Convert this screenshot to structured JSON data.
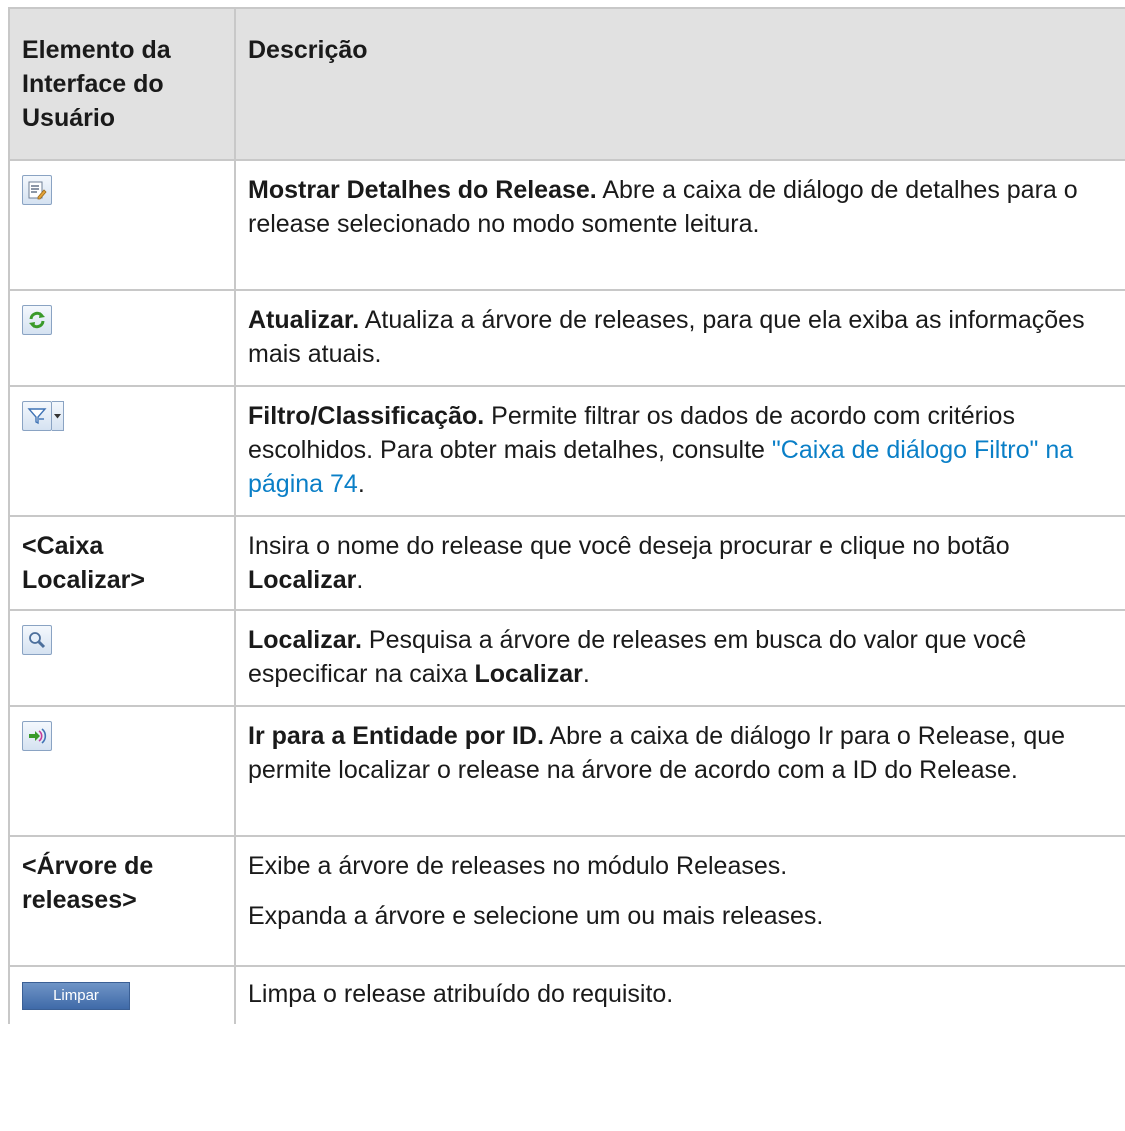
{
  "header": {
    "col1": "Elemento da Interface do Usuário",
    "col2": "Descrição"
  },
  "rows": [
    {
      "icon": "release-details-icon",
      "title": "Mostrar Detalhes do Release.",
      "desc": " Abre a caixa de diálogo de detalhes para o release selecionado no modo somente leitura."
    },
    {
      "icon": "refresh-icon",
      "title": "Atualizar.",
      "desc": " Atualiza a árvore de releases, para que ela exiba as informações mais atuais."
    },
    {
      "icon": "filter-icon",
      "title": "Filtro/Classificação.",
      "desc": " Permite filtrar os dados de acordo com critérios escolhidos. Para obter mais detalhes, consulte ",
      "link": "\"Caixa de diálogo Filtro\" na página 74",
      "desc_end": "."
    },
    {
      "element": "<Caixa Localizar>",
      "desc": "Insira o nome do release que você deseja procurar e clique no botão ",
      "bold": "Localizar",
      "desc_end": "."
    },
    {
      "icon": "find-icon",
      "title": "Localizar.",
      "desc": " Pesquisa a árvore de releases em busca do valor que você especificar na caixa ",
      "bold": "Localizar",
      "desc_end": "."
    },
    {
      "icon": "go-to-entity-icon",
      "title": "Ir para a Entidade por ID.",
      "desc": " Abre a caixa de diálogo Ir para o Release, que permite localizar o release na árvore de acordo com a ID do Release."
    },
    {
      "element": "<Árvore de releases>",
      "desc": "Exibe a árvore de releases no módulo Releases.",
      "desc2": "Expanda a árvore e selecione um ou mais releases."
    },
    {
      "button_label": "Limpar",
      "desc": "Limpa o release atribuído do requisito."
    }
  ]
}
